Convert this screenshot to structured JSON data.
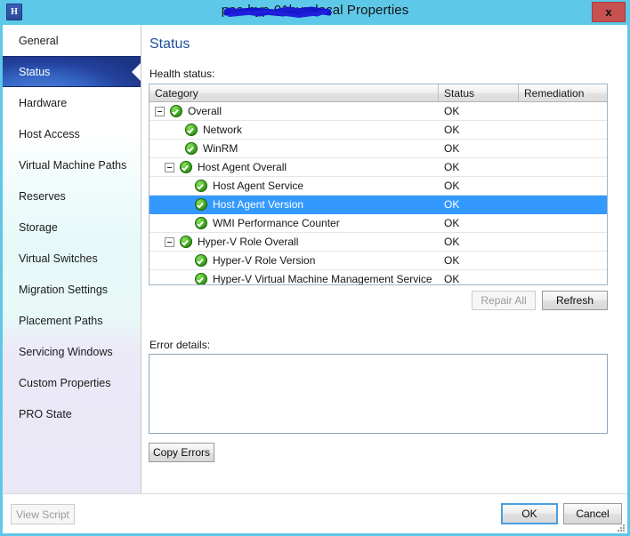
{
  "window": {
    "title": "poc-hyp-01hyp-local Properties",
    "title_visible_suffix": "al Properties",
    "title_redacted": true,
    "app_icon": "hyperv-host-icon",
    "app_icon_glyph": "H",
    "close_label": "x",
    "frame_color": "#5ec8e8",
    "close_color": "#c75050"
  },
  "sidebar": {
    "items": [
      {
        "label": "General",
        "selected": false
      },
      {
        "label": "Status",
        "selected": true
      },
      {
        "label": "Hardware",
        "selected": false
      },
      {
        "label": "Host Access",
        "selected": false
      },
      {
        "label": "Virtual Machine Paths",
        "selected": false
      },
      {
        "label": "Reserves",
        "selected": false
      },
      {
        "label": "Storage",
        "selected": false
      },
      {
        "label": "Virtual Switches",
        "selected": false
      },
      {
        "label": "Migration Settings",
        "selected": false
      },
      {
        "label": "Placement Paths",
        "selected": false
      },
      {
        "label": "Servicing Windows",
        "selected": false
      },
      {
        "label": "Custom Properties",
        "selected": false
      },
      {
        "label": "PRO State",
        "selected": false
      }
    ],
    "selected_color": "#23419c"
  },
  "main": {
    "page_title": "Status",
    "page_title_color": "#1f4e9c",
    "health_label": "Health status:",
    "error_label": "Error details:",
    "error_value": "",
    "error_placeholder": ""
  },
  "table": {
    "columns": [
      "Category",
      "Status",
      "Remediation"
    ],
    "selected_row_index": 5,
    "selection_color": "#3399ff",
    "rows": [
      {
        "category": "Overall",
        "status": "OK",
        "remediation": "",
        "indent": 0,
        "expander": "collapse",
        "icon": "status-ok-icon"
      },
      {
        "category": "Network",
        "status": "OK",
        "remediation": "",
        "indent": 1,
        "expander": "none",
        "icon": "status-ok-icon"
      },
      {
        "category": "WinRM",
        "status": "OK",
        "remediation": "",
        "indent": 1,
        "expander": "none",
        "icon": "status-ok-icon"
      },
      {
        "category": "Host Agent Overall",
        "status": "OK",
        "remediation": "",
        "indent": 1,
        "expander": "collapse",
        "icon": "status-ok-icon"
      },
      {
        "category": "Host Agent Service",
        "status": "OK",
        "remediation": "",
        "indent": 2,
        "expander": "none",
        "icon": "status-ok-icon"
      },
      {
        "category": "Host Agent Version",
        "status": "OK",
        "remediation": "",
        "indent": 2,
        "expander": "none",
        "icon": "status-ok-icon"
      },
      {
        "category": "WMI Performance Counter",
        "status": "OK",
        "remediation": "",
        "indent": 2,
        "expander": "none",
        "icon": "status-ok-icon"
      },
      {
        "category": "Hyper-V Role Overall",
        "status": "OK",
        "remediation": "",
        "indent": 1,
        "expander": "collapse",
        "icon": "status-ok-icon"
      },
      {
        "category": "Hyper-V Role Version",
        "status": "OK",
        "remediation": "",
        "indent": 2,
        "expander": "none",
        "icon": "status-ok-icon"
      },
      {
        "category": "Hyper-V Virtual Machine Management Service",
        "status": "OK",
        "remediation": "",
        "indent": 2,
        "expander": "none",
        "icon": "status-ok-icon"
      }
    ]
  },
  "buttons": {
    "repair_all": {
      "label": "Repair All",
      "enabled": false
    },
    "refresh": {
      "label": "Refresh",
      "enabled": true
    },
    "copy_errors": {
      "label": "Copy Errors",
      "enabled": true
    },
    "view_script": {
      "label": "View Script",
      "enabled": false
    },
    "ok": {
      "label": "OK",
      "enabled": true,
      "default": true
    },
    "cancel": {
      "label": "Cancel",
      "enabled": true
    }
  }
}
